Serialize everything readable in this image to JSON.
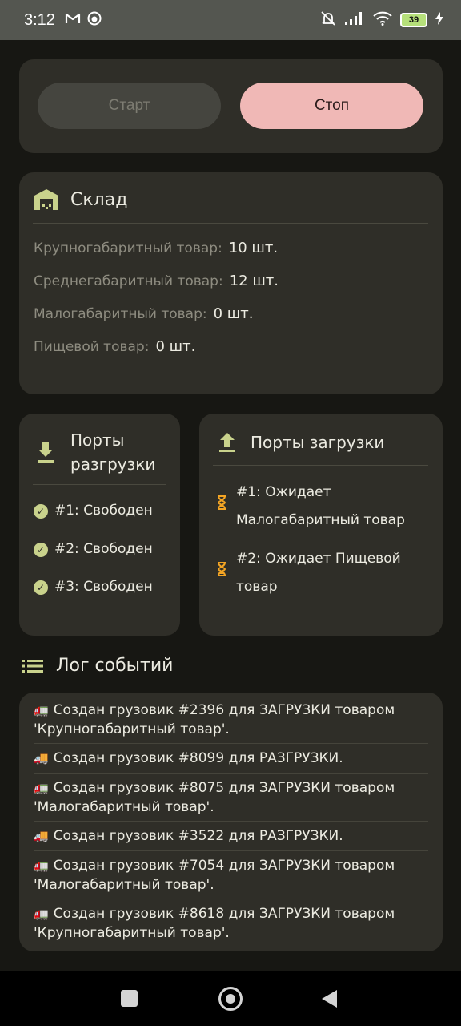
{
  "status_bar": {
    "time": "3:12",
    "battery": "39"
  },
  "controls": {
    "start_label": "Старт",
    "stop_label": "Стоп"
  },
  "warehouse": {
    "title": "Склад",
    "items": [
      {
        "label": "Крупногабаритный товар:",
        "value": "10 шт."
      },
      {
        "label": "Среднегабаритный товар:",
        "value": "12 шт."
      },
      {
        "label": "Малогабаритный товар:",
        "value": "0 шт."
      },
      {
        "label": "Пищевой товар:",
        "value": "0 шт."
      }
    ]
  },
  "unload_ports": {
    "title_line1": "Порты",
    "title_line2": "разгрузки",
    "items": [
      "#1: Свободен",
      "#2: Свободен",
      "#3: Свободен"
    ]
  },
  "load_ports": {
    "title": "Порты загрузки",
    "items": [
      {
        "line1": "#1: Ожидает",
        "line2": "Малогабаритный товар"
      },
      {
        "line1": "#2: Ожидает Пищевой",
        "line2": "товар"
      }
    ]
  },
  "log": {
    "title": "Лог событий",
    "entries": [
      {
        "line1": "Создан грузовик #2396 для ЗАГРУЗКИ товаром",
        "line2": "'Крупногабаритный товар'.",
        "icon": "delivery-truck-icon"
      },
      {
        "line1": "Создан грузовик #8099 для РАЗГРУЗКИ.",
        "line2": "",
        "icon": "moving-truck-icon"
      },
      {
        "line1": "Создан грузовик #8075 для ЗАГРУЗКИ товаром",
        "line2": "'Малогабаритный товар'.",
        "icon": "delivery-truck-icon"
      },
      {
        "line1": "Создан грузовик #3522 для РАЗГРУЗКИ.",
        "line2": "",
        "icon": "moving-truck-icon"
      },
      {
        "line1": "Создан грузовик #7054 для ЗАГРУЗКИ товаром",
        "line2": "'Малогабаритный товар'.",
        "icon": "delivery-truck-icon"
      },
      {
        "line1": "Создан грузовик #8618 для ЗАГРУЗКИ товаром",
        "line2": "'Крупногабаритный товар'.",
        "icon": "delivery-truck-icon"
      }
    ]
  },
  "colors": {
    "accent_stop": "#f0b8b6",
    "icon_green": "#c9d28c",
    "hourglass_orange": "#f4a524"
  }
}
